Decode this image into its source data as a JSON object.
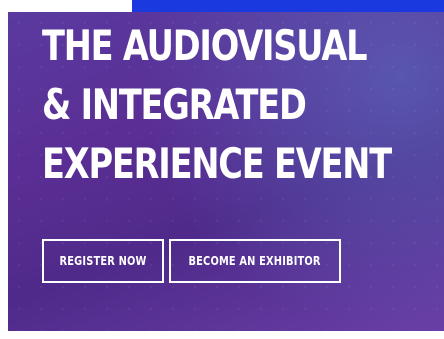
{
  "hero": {
    "headline_lines": [
      "THE AUDIOVISUAL",
      "& INTEGRATED",
      "EXPERIENCE EVENT"
    ],
    "register_label": "REGISTER NOW",
    "exhibitor_label": "BECOME AN EXHIBITOR"
  },
  "colors": {
    "background_primary": "#5a2e94",
    "background_accent": "#5a78c8",
    "top_link_bar": "#1a3adf",
    "text": "#ffffff"
  }
}
